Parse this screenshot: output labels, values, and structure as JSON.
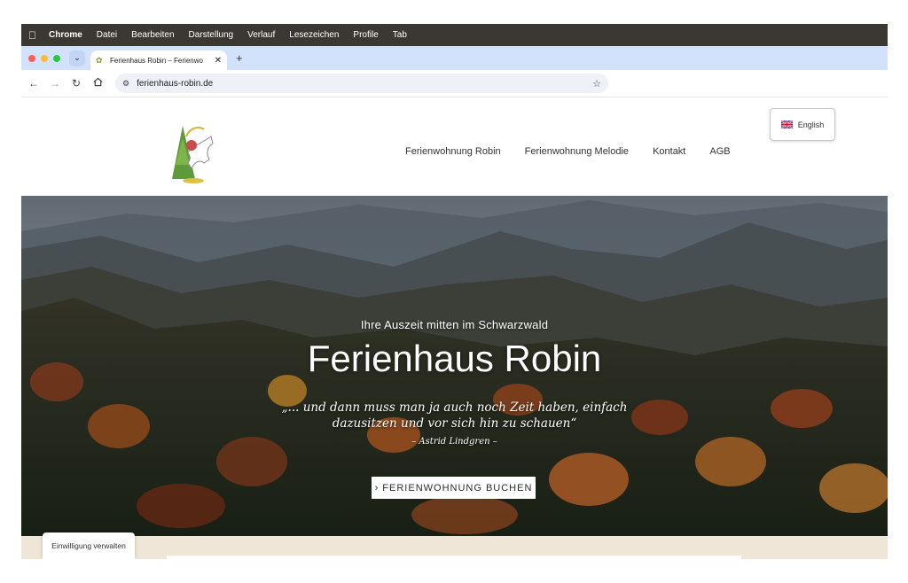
{
  "menubar": {
    "app": "Chrome",
    "items": [
      "Datei",
      "Bearbeiten",
      "Darstellung",
      "Verlauf",
      "Lesezeichen",
      "Profile",
      "Tab"
    ]
  },
  "browser": {
    "tab_title": "Ferienhaus Robin – Ferienwo",
    "url": "ferienhaus-robin.de"
  },
  "site": {
    "nav": [
      "Ferienwohnung Robin",
      "Ferienwohnung Melodie",
      "Kontakt",
      "AGB"
    ],
    "language": "English",
    "hero": {
      "tagline": "Ihre Auszeit mitten im Schwarzwald",
      "title": "Ferienhaus Robin",
      "quote": "„... und dann muss man ja auch noch Zeit haben, einfach dazusitzen und vor sich hin zu schauen“",
      "author": "– Astrid Lindgren –",
      "cta": "› FERIENWOHNUNG BUCHEN"
    },
    "consent": "Einwilligung verwalten"
  },
  "colors": {
    "menubar": "#3b3833",
    "tabstrip": "#d3e2fc",
    "below_hero": "#efe6d8"
  }
}
